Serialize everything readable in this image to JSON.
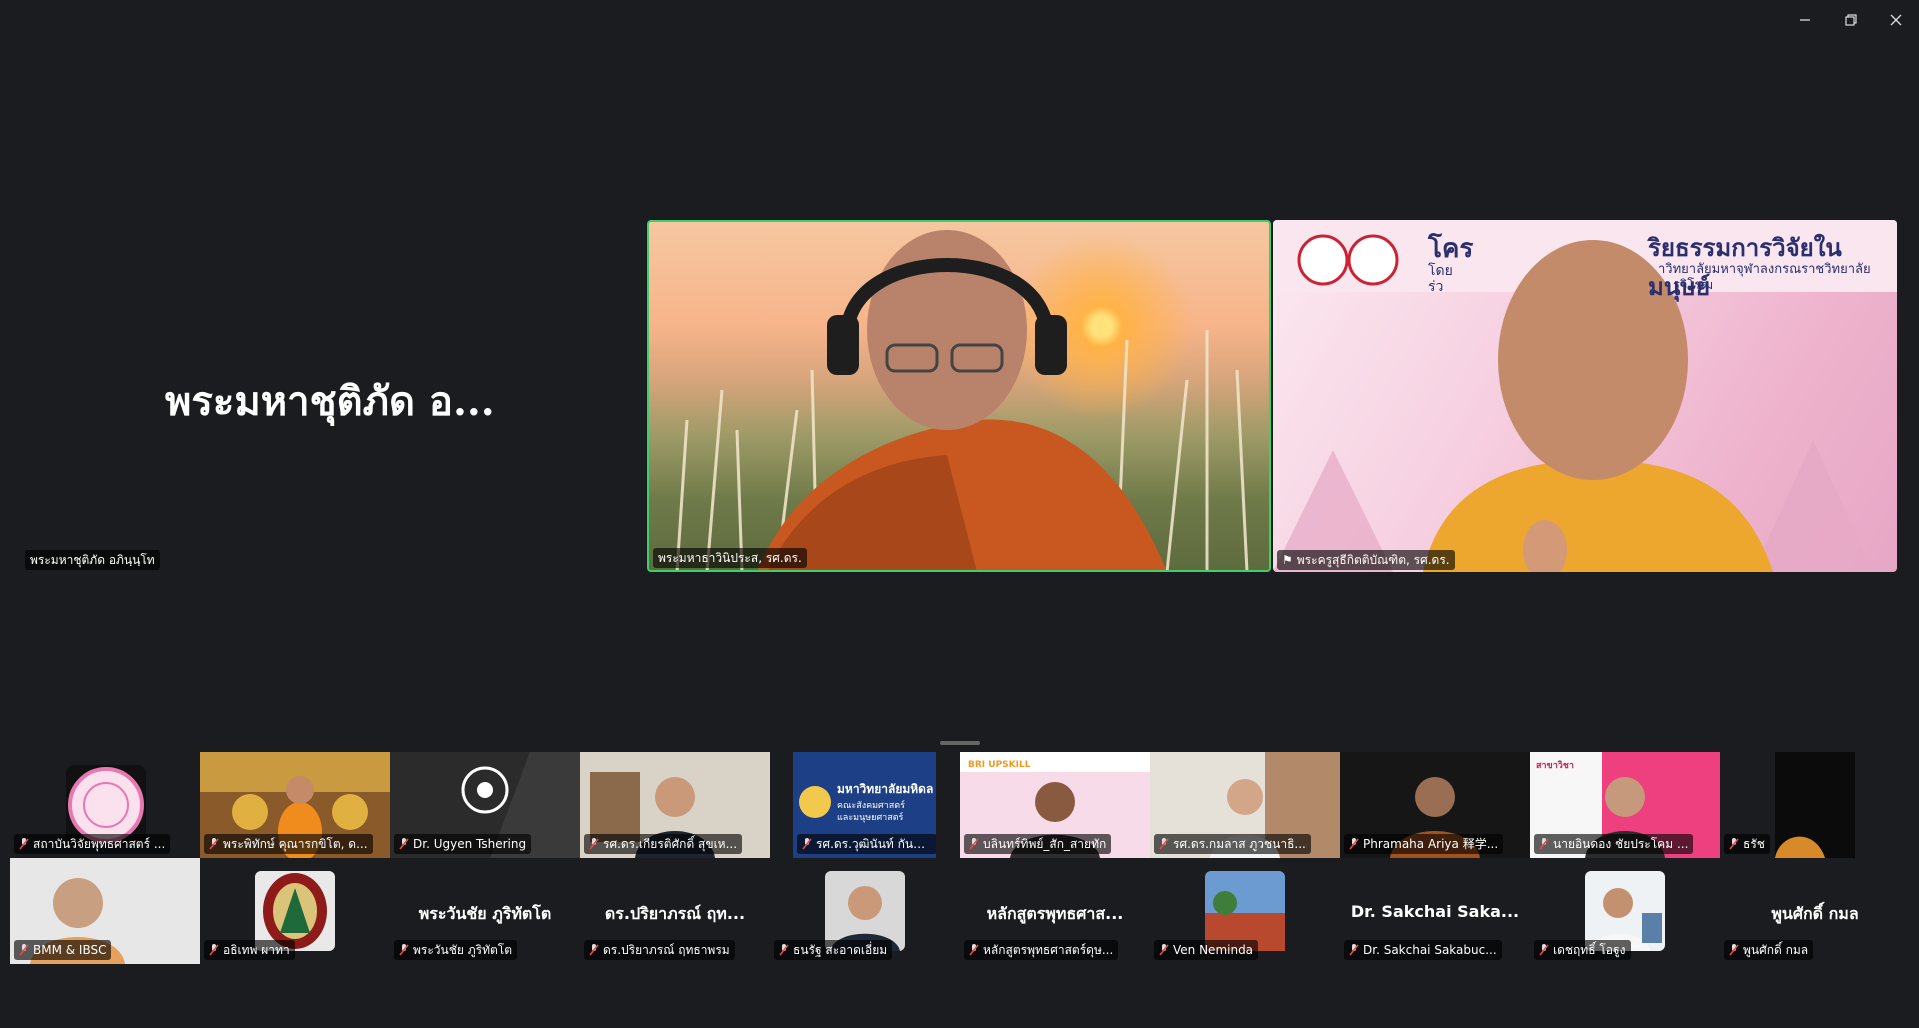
{
  "window": {
    "controls": [
      "minimize-icon",
      "restore-icon",
      "close-icon"
    ]
  },
  "colors": {
    "background": "#1a1c1f",
    "active_speaker_border": "#3ccf6a",
    "mic_muted": "#e8494a"
  },
  "speaker": {
    "big_name": "พระมหาชุติภัด อ...",
    "label": "พระมหาชุติภัด อภินฺนฺโท"
  },
  "main_videos": [
    {
      "label": "พระมหาธาวินิประส, รศ.ดร.",
      "active": true
    },
    {
      "label": "พระครูสุธีกิตติบัณฑิต, รศ.ดร.",
      "slide_title": "โคร",
      "slide_title_right": "ริยธรรมการวิจัยในมนุษย์",
      "slide_sub_left": "โดย",
      "slide_sub_right": "าวิทยาลัยมหาจุฬาลงกรณราชวิทยาลัย",
      "slide_sub2_left": "ร่ว",
      "slide_sub2_right": "รวิโรฒ"
    }
  ],
  "thumbnails_row1": [
    {
      "label": "สถาบันวิจัยพุทธศาสตร์ ...",
      "muted": true
    },
    {
      "label": "พระพิทักษ์ คุณารกขิโต, ด...",
      "muted": true
    },
    {
      "label": "Dr. Ugyen Tshering",
      "muted": true
    },
    {
      "label": "รศ.ดร.เกียรติศักดิ์ สุขเห...",
      "muted": true
    },
    {
      "label": "รศ.ดร.วุฒินันท์ กันทะตี...",
      "muted": true,
      "slide_title": "มหาวิทยาลัยมหิดล",
      "slide_sub": "คณะสังคมศาสตร์",
      "slide_sub2": "และมนุษยศาสตร์"
    },
    {
      "label": "บลินทร์ทิพย์_สัก_สายทัก",
      "muted": true,
      "slide_logo": "BRI UPSKILL"
    },
    {
      "label": "รศ.ดร.กมลาส ภูวชนาธิ...",
      "muted": true
    },
    {
      "label": "Phramaha Ariya 释学...",
      "muted": true
    },
    {
      "label": "นายอินดอง ชัยประโคม ...",
      "muted": true,
      "slide_tag": "สาขาวิชา"
    },
    {
      "label": "ธรัช",
      "muted": true
    }
  ],
  "thumbnails_row2": [
    {
      "label": "BMM & IBSC",
      "muted": true,
      "big": ""
    },
    {
      "label": "อธิเทพ ผาทา",
      "muted": true,
      "big": ""
    },
    {
      "label": "พระวันชัย ภูริทัตโต",
      "muted": true,
      "big": "พระวันชัย ภูริทัตโต"
    },
    {
      "label": "ดร.ปริยาภรณ์ ฤทธาพรม",
      "muted": true,
      "big": "ดร.ปริยาภรณ์ ฤท..."
    },
    {
      "label": "ธนรัฐ สะอาดเอี่ยม",
      "muted": true,
      "big": ""
    },
    {
      "label": "หลักสูตรพุทธศาสตร์ดุษ...",
      "muted": true,
      "big": "หลักสูตรพุทธศาส..."
    },
    {
      "label": "Ven Neminda",
      "muted": true,
      "big": ""
    },
    {
      "label": "Dr. Sakchai Sakabuc...",
      "muted": true,
      "big": "Dr. Sakchai Saka..."
    },
    {
      "label": "เดชฤทธิ์ โอฐูง",
      "muted": true,
      "big": ""
    },
    {
      "label": "พูนศักดิ์ กมล",
      "muted": true,
      "big": "พูนศักดิ์ กมล"
    }
  ]
}
